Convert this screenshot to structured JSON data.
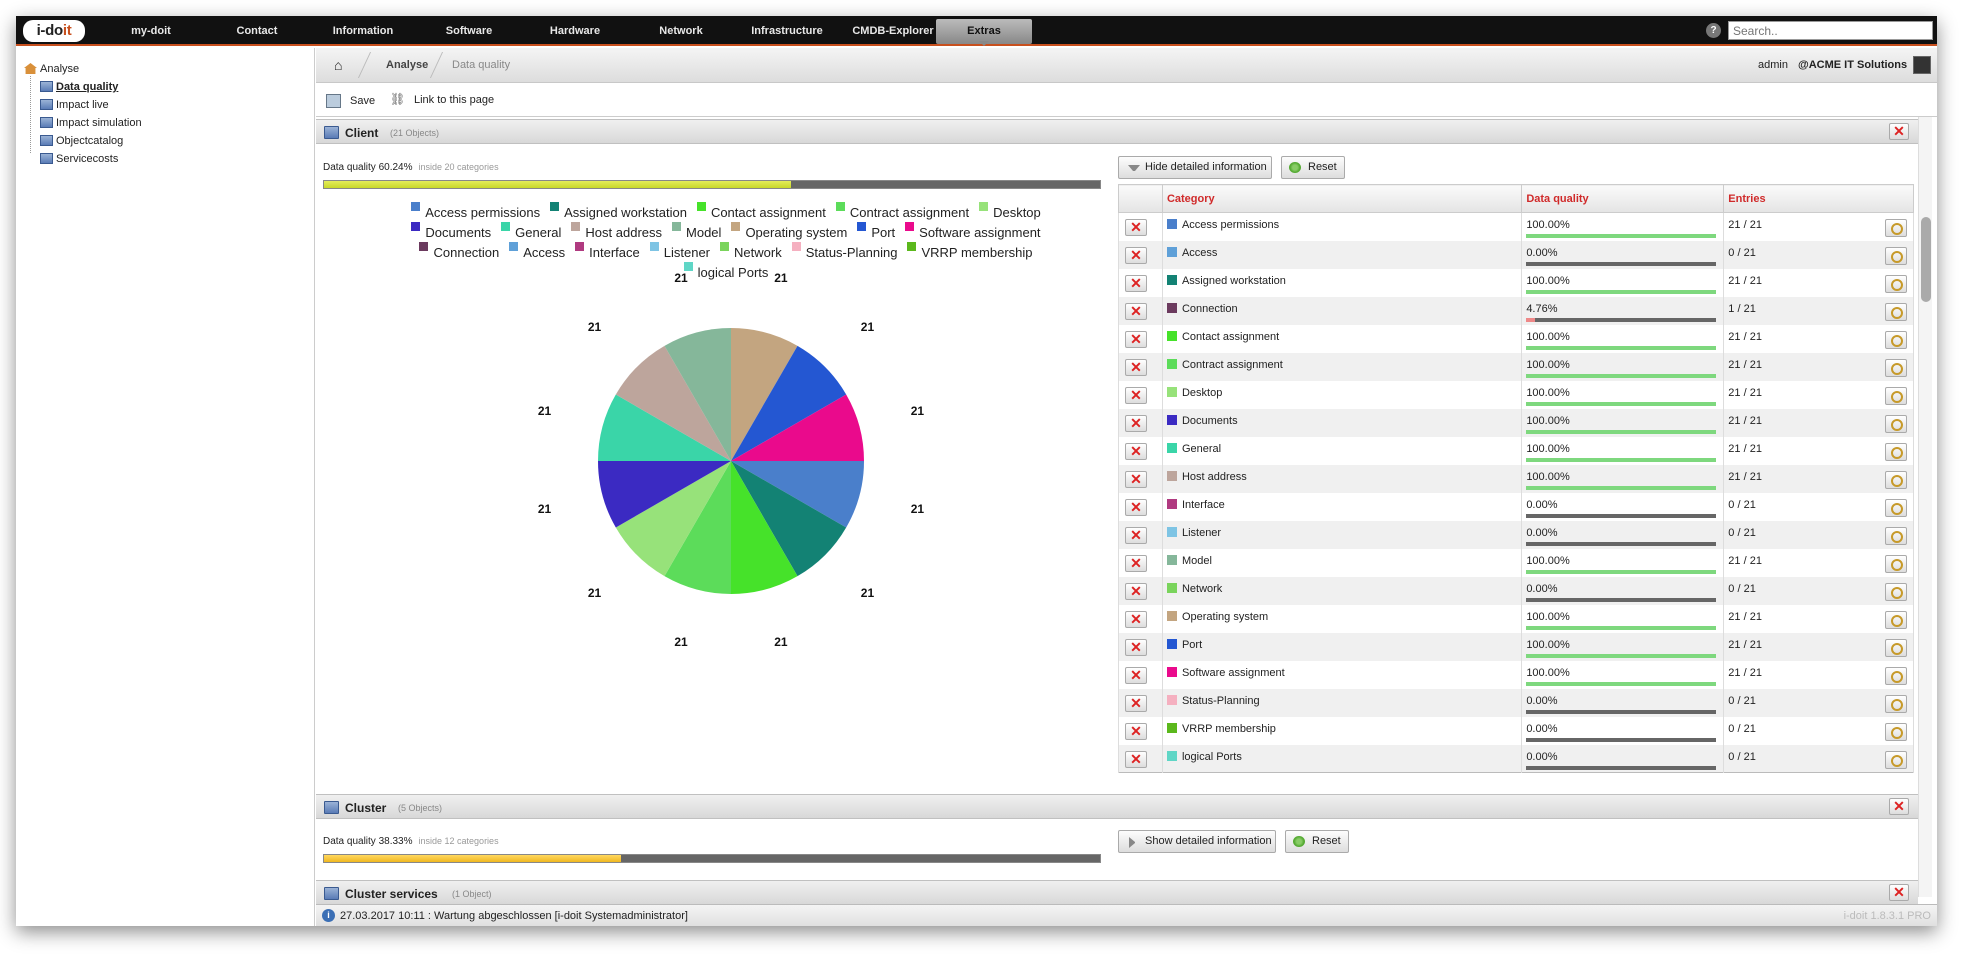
{
  "app": {
    "logo_main": "i-do",
    "logo_accent": "it",
    "version": "i-doit 1.8.3.1 PRO"
  },
  "nav": [
    "my-doit",
    "Contact",
    "Information",
    "Software",
    "Hardware",
    "Network",
    "Infrastructure",
    "CMDB-Explorer",
    "Extras"
  ],
  "search": {
    "placeholder": "Search.."
  },
  "sidebar": {
    "root": "Analyse",
    "items": [
      "Data quality",
      "Impact live",
      "Impact simulation",
      "Objectcatalog",
      "Servicecosts"
    ]
  },
  "breadcrumb": {
    "items": [
      "Analyse",
      "Data quality"
    ],
    "user": "admin",
    "tenant": "@ACME IT Solutions"
  },
  "toolbar": {
    "save": "Save",
    "link": "Link to this page"
  },
  "sections": {
    "client": {
      "title": "Client",
      "count": "(21 Objects)",
      "quality": "Data quality 60.24%",
      "inside": "inside 20 categories",
      "percent": 60.24,
      "toggle": "Hide detailed information",
      "reset": "Reset"
    },
    "cluster": {
      "title": "Cluster",
      "count": "(5 Objects)",
      "quality": "Data quality 38.33%",
      "inside": "inside 12 categories",
      "percent": 38.33,
      "toggle": "Show detailed information",
      "reset": "Reset"
    },
    "cluster_services": {
      "title": "Cluster services",
      "count": "(1 Object)"
    }
  },
  "table": {
    "headers": {
      "category": "Category",
      "quality": "Data quality",
      "entries": "Entries"
    },
    "rows": [
      {
        "category": "Access permissions",
        "color": "#4a7fcb",
        "quality": "100.00%",
        "pct": 100,
        "entries": "21 / 21"
      },
      {
        "category": "Access",
        "color": "#5fa0d8",
        "quality": "0.00%",
        "pct": 0,
        "entries": "0 / 21"
      },
      {
        "category": "Assigned workstation",
        "color": "#138274",
        "quality": "100.00%",
        "pct": 100,
        "entries": "21 / 21"
      },
      {
        "category": "Connection",
        "color": "#6b3a5e",
        "quality": "4.76%",
        "pct": 4.76,
        "entries": "1 / 21"
      },
      {
        "category": "Contact assignment",
        "color": "#46e22a",
        "quality": "100.00%",
        "pct": 100,
        "entries": "21 / 21"
      },
      {
        "category": "Contract assignment",
        "color": "#5cdc5a",
        "quality": "100.00%",
        "pct": 100,
        "entries": "21 / 21"
      },
      {
        "category": "Desktop",
        "color": "#97e27a",
        "quality": "100.00%",
        "pct": 100,
        "entries": "21 / 21"
      },
      {
        "category": "Documents",
        "color": "#3b2ac2",
        "quality": "100.00%",
        "pct": 100,
        "entries": "21 / 21"
      },
      {
        "category": "General",
        "color": "#3ad5a8",
        "quality": "100.00%",
        "pct": 100,
        "entries": "21 / 21"
      },
      {
        "category": "Host address",
        "color": "#bda59c",
        "quality": "100.00%",
        "pct": 100,
        "entries": "21 / 21"
      },
      {
        "category": "Interface",
        "color": "#b03a80",
        "quality": "0.00%",
        "pct": 0,
        "entries": "0 / 21"
      },
      {
        "category": "Listener",
        "color": "#7ec4e4",
        "quality": "0.00%",
        "pct": 0,
        "entries": "0 / 21"
      },
      {
        "category": "Model",
        "color": "#85b79a",
        "quality": "100.00%",
        "pct": 100,
        "entries": "21 / 21"
      },
      {
        "category": "Network",
        "color": "#7ad45c",
        "quality": "0.00%",
        "pct": 0,
        "entries": "0 / 21"
      },
      {
        "category": "Operating system",
        "color": "#c3a580",
        "quality": "100.00%",
        "pct": 100,
        "entries": "21 / 21"
      },
      {
        "category": "Port",
        "color": "#2457d2",
        "quality": "100.00%",
        "pct": 100,
        "entries": "21 / 21"
      },
      {
        "category": "Software assignment",
        "color": "#ea0a8c",
        "quality": "100.00%",
        "pct": 100,
        "entries": "21 / 21"
      },
      {
        "category": "Status-Planning",
        "color": "#f5b0c0",
        "quality": "0.00%",
        "pct": 0,
        "entries": "0 / 21"
      },
      {
        "category": "VRRP membership",
        "color": "#5bb81c",
        "quality": "0.00%",
        "pct": 0,
        "entries": "0 / 21"
      },
      {
        "category": "logical Ports",
        "color": "#5fd6c6",
        "quality": "0.00%",
        "pct": 0,
        "entries": "0 / 21"
      }
    ]
  },
  "chart_data": {
    "type": "pie",
    "title": "",
    "legend": [
      {
        "name": "Access permissions",
        "color": "#4a7fcb"
      },
      {
        "name": "Assigned workstation",
        "color": "#138274"
      },
      {
        "name": "Contact assignment",
        "color": "#46e22a"
      },
      {
        "name": "Contract assignment",
        "color": "#5cdc5a"
      },
      {
        "name": "Desktop",
        "color": "#97e27a"
      },
      {
        "name": "Documents",
        "color": "#3b2ac2"
      },
      {
        "name": "General",
        "color": "#3ad5a8"
      },
      {
        "name": "Host address",
        "color": "#bda59c"
      },
      {
        "name": "Model",
        "color": "#85b79a"
      },
      {
        "name": "Operating system",
        "color": "#c3a580"
      },
      {
        "name": "Port",
        "color": "#2457d2"
      },
      {
        "name": "Software assignment",
        "color": "#ea0a8c"
      },
      {
        "name": "Connection",
        "color": "#6b3a5e"
      },
      {
        "name": "Access",
        "color": "#5fa0d8"
      },
      {
        "name": "Interface",
        "color": "#b03a80"
      },
      {
        "name": "Listener",
        "color": "#7ec4e4"
      },
      {
        "name": "Network",
        "color": "#7ad45c"
      },
      {
        "name": "Status-Planning",
        "color": "#f5b0c0"
      },
      {
        "name": "VRRP membership",
        "color": "#5bb81c"
      },
      {
        "name": "logical Ports",
        "color": "#5fd6c6"
      }
    ],
    "slices": [
      {
        "name": "Operating system",
        "value": 21,
        "color": "#c3a580"
      },
      {
        "name": "Port",
        "value": 21,
        "color": "#2457d2"
      },
      {
        "name": "Software assignment",
        "value": 21,
        "color": "#ea0a8c"
      },
      {
        "name": "Access permissions",
        "value": 21,
        "color": "#4a7fcb"
      },
      {
        "name": "Assigned workstation",
        "value": 21,
        "color": "#138274"
      },
      {
        "name": "Contact assignment",
        "value": 21,
        "color": "#46e22a"
      },
      {
        "name": "Contract assignment",
        "value": 21,
        "color": "#5cdc5a"
      },
      {
        "name": "Desktop",
        "value": 21,
        "color": "#97e27a"
      },
      {
        "name": "Documents",
        "value": 21,
        "color": "#3b2ac2"
      },
      {
        "name": "General",
        "value": 21,
        "color": "#3ad5a8"
      },
      {
        "name": "Host address",
        "value": 21,
        "color": "#bda59c"
      },
      {
        "name": "Model",
        "value": 21,
        "color": "#85b79a"
      }
    ],
    "legend_position": "top"
  },
  "status": {
    "message": "27.03.2017 10:11 : Wartung abgeschlossen [i-doit Systemadministrator]"
  }
}
